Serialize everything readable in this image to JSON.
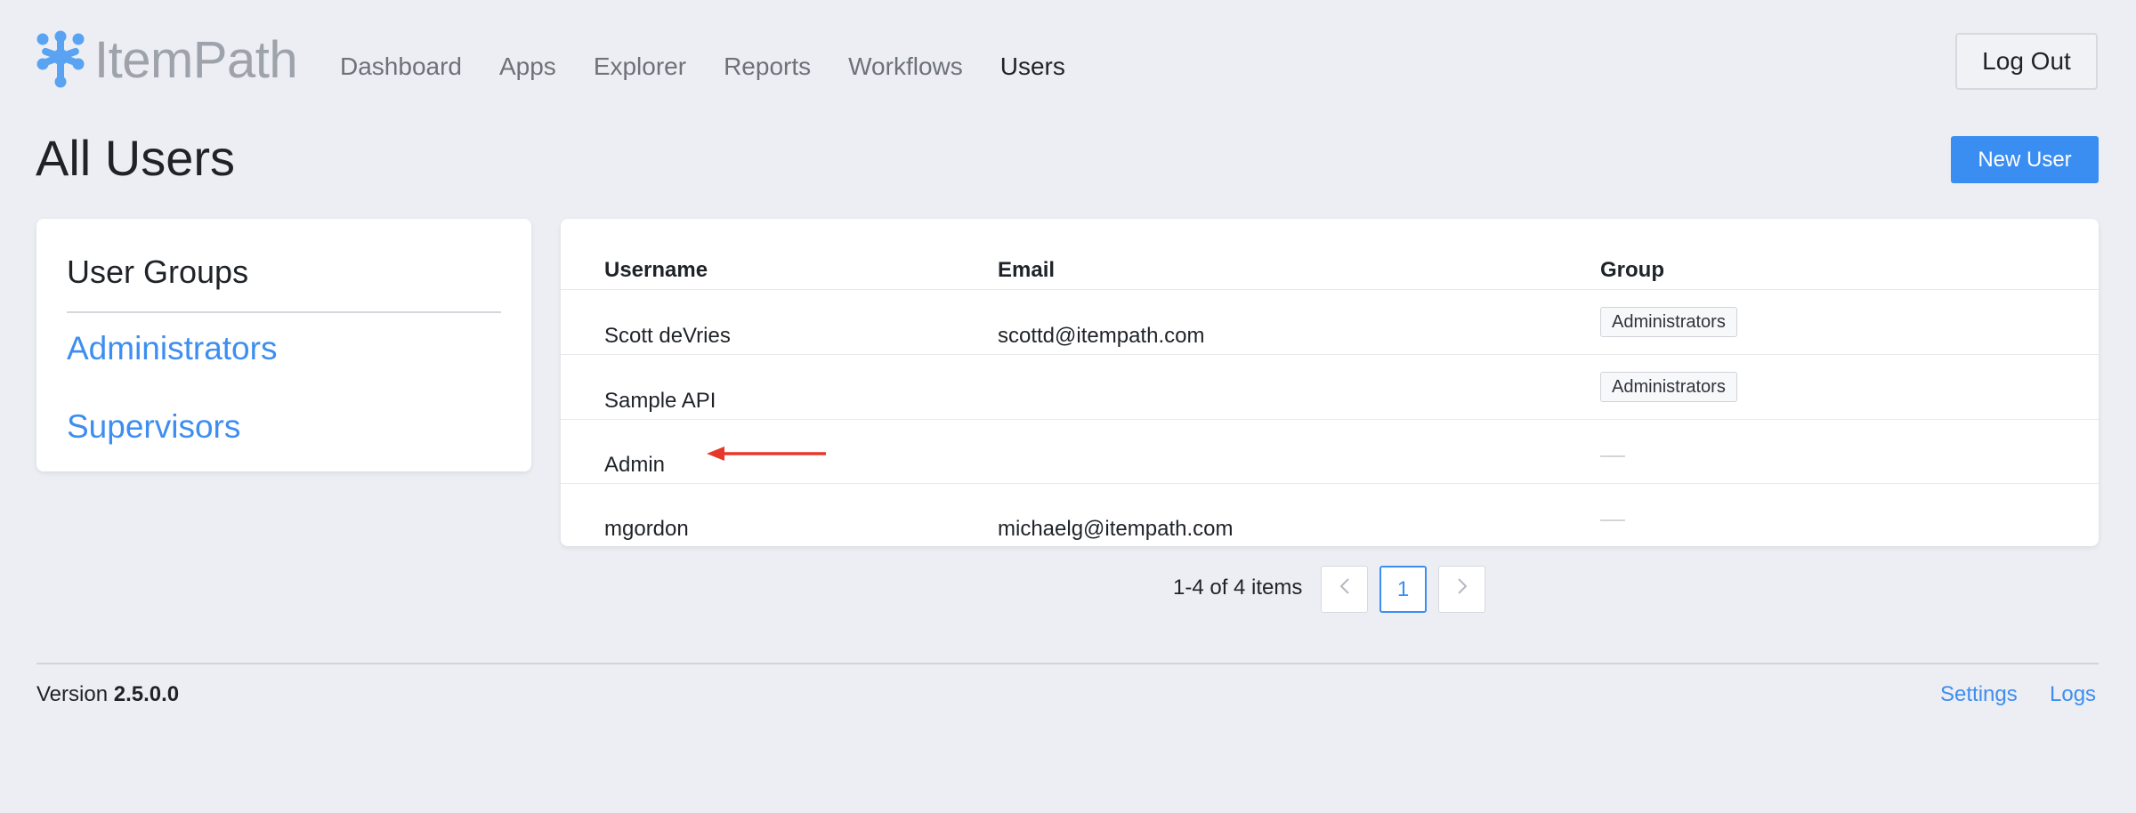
{
  "brand": {
    "name": "ItemPath",
    "logo_color": "#5aa3f2"
  },
  "nav": {
    "items": [
      {
        "label": "Dashboard"
      },
      {
        "label": "Apps"
      },
      {
        "label": "Explorer"
      },
      {
        "label": "Reports"
      },
      {
        "label": "Workflows"
      },
      {
        "label": "Users",
        "active": true
      }
    ]
  },
  "header": {
    "logout_label": "Log Out"
  },
  "page": {
    "title": "All Users",
    "new_user_label": "New User"
  },
  "groups": {
    "title": "User Groups",
    "items": [
      {
        "label": "Administrators"
      },
      {
        "label": "Supervisors"
      }
    ]
  },
  "table": {
    "columns": [
      "Username",
      "Email",
      "Group"
    ],
    "rows": [
      {
        "username": "Scott deVries",
        "email": "scottd@itempath.com",
        "group": "Administrators"
      },
      {
        "username": "Sample API",
        "email": "",
        "group": "Administrators"
      },
      {
        "username": "Admin",
        "email": "",
        "group": ""
      },
      {
        "username": "mgordon",
        "email": "michaelg@itempath.com",
        "group": ""
      }
    ],
    "annotation": {
      "icon": "red-arrow-icon",
      "color": "#e8382c"
    }
  },
  "pagination": {
    "info": "1-4 of 4 items",
    "prev_icon": "chevron-left-icon",
    "current_page": "1",
    "next_icon": "chevron-right-icon"
  },
  "footer": {
    "version_label": "Version",
    "version_value": "2.5.0.0",
    "links": [
      {
        "label": "Settings"
      },
      {
        "label": "Logs"
      }
    ]
  },
  "colors": {
    "background": "#eceef3",
    "accent": "#3b8ef1",
    "link": "#3d8ef0"
  }
}
